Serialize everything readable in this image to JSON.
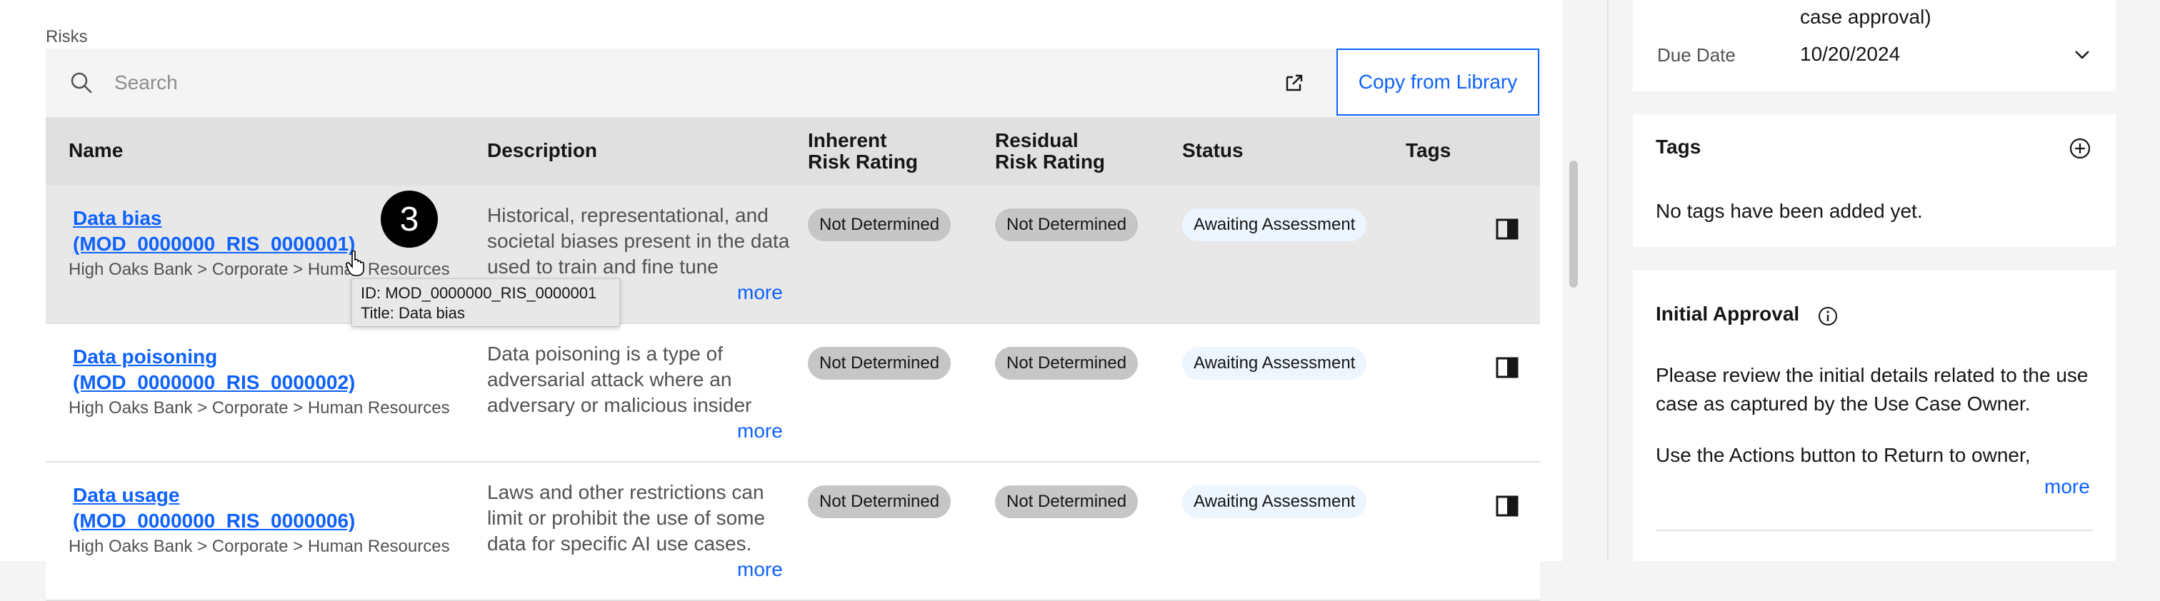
{
  "risks": {
    "section_label": "Risks",
    "search_placeholder": "Search",
    "copy_button": "Copy from Library",
    "headers": {
      "name": "Name",
      "description": "Description",
      "inherent_line1": "Inherent",
      "inherent_line2": "Risk Rating",
      "residual_line1": "Residual",
      "residual_line2": "Risk Rating",
      "status": "Status",
      "tags": "Tags"
    },
    "rows": [
      {
        "name_line1": "Data bias",
        "name_line2": "(MOD_0000000_RIS_0000001)",
        "path": "High Oaks Bank > Corporate > Human Resources",
        "description": "Historical, representational, and societal biases present in the data used to train and fine tune",
        "more": "more",
        "inherent": "Not Determined",
        "residual": "Not Determined",
        "status": "Awaiting Assessment"
      },
      {
        "name_line1": "Data poisoning",
        "name_line2": "(MOD_0000000_RIS_0000002)",
        "path": "High Oaks Bank > Corporate > Human Resources",
        "description": "Data poisoning is a type of adversarial attack where an adversary or malicious insider",
        "more": "more",
        "inherent": "Not Determined",
        "residual": "Not Determined",
        "status": "Awaiting Assessment"
      },
      {
        "name_line1": "Data usage",
        "name_line2": "(MOD_0000000_RIS_0000006)",
        "path": "High Oaks Bank > Corporate > Human Resources",
        "description": "Laws and other restrictions can limit or prohibit the use of some data for specific AI use cases.",
        "more": "more",
        "inherent": "Not Determined",
        "residual": "Not Determined",
        "status": "Awaiting Assessment"
      }
    ],
    "tooltip": {
      "id_line": "ID: MOD_0000000_RIS_0000001",
      "title_line": "Title: Data bias"
    },
    "step_badge": "3"
  },
  "details": {
    "prev_value_tail": "case approval)",
    "due_date_label": "Due Date",
    "due_date_value": "10/20/2024"
  },
  "tags_panel": {
    "title": "Tags",
    "empty_text": "No tags have been added yet."
  },
  "approval_panel": {
    "title": "Initial Approval",
    "paragraph1": "Please review the initial details related to the use case as captured by the Use Case Owner.",
    "paragraph2": "Use the Actions button to Return to owner,",
    "more": "more"
  },
  "colors": {
    "accent": "#0f62fe",
    "tag_grey": "#c6c6c6",
    "status_blue_bg": "#edf5ff"
  },
  "icons": [
    "search-icon",
    "launch-icon",
    "sidepanel-icon",
    "add-icon",
    "info-icon",
    "chevron-down-icon"
  ]
}
